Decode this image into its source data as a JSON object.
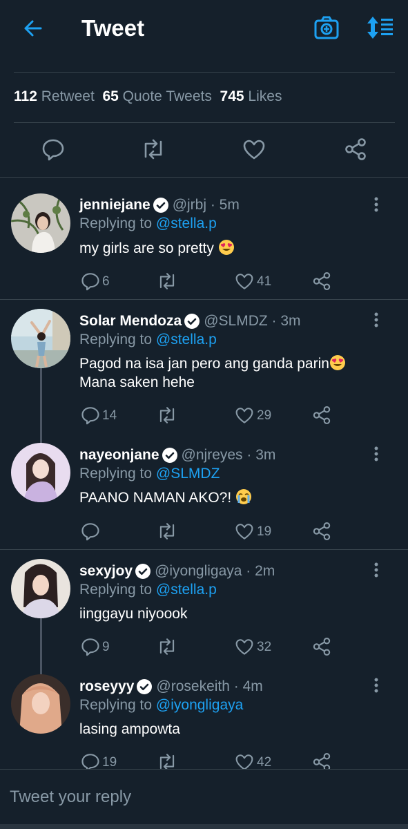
{
  "header": {
    "title": "Tweet"
  },
  "stats": {
    "retweets": "112",
    "retweets_label": "Retweet",
    "quotes": "65",
    "quotes_label": "Quote Tweets",
    "likes": "745",
    "likes_label": "Likes"
  },
  "replies": [
    {
      "name": "jenniejane",
      "handle": "@jrbj · 5m",
      "replying_prefix": "Replying to",
      "replying_to": "@stella.p",
      "text": "my girls are so pretty",
      "comments": "6",
      "likes": "41"
    },
    {
      "name": "Solar Mendoza",
      "handle": "@SLMDZ · 3m",
      "replying_prefix": "Replying to",
      "replying_to": "@stella.p",
      "text": "Pagod na isa jan pero ang ganda parin",
      "text2": "Mana saken hehe",
      "comments": "14",
      "likes": "29"
    },
    {
      "name": "nayeonjane",
      "handle": "@njreyes · 3m",
      "replying_prefix": "Replying to",
      "replying_to": "@SLMDZ",
      "text": "PAANO NAMAN AKO?!",
      "comments": "",
      "likes": "19"
    },
    {
      "name": "sexyjoy",
      "handle": "@iyongligaya · 2m",
      "replying_prefix": "Replying to",
      "replying_to": "@stella.p",
      "text": "iinggayu niyoook",
      "comments": "9",
      "likes": "32"
    },
    {
      "name": "roseyyy",
      "handle": "@rosekeith · 4m",
      "replying_prefix": "Replying to",
      "replying_to": "@iyongligaya",
      "text": "lasing ampowta",
      "comments": "19",
      "likes": "42"
    }
  ],
  "compose": {
    "placeholder": "Tweet your reply"
  },
  "colors": {
    "background": "#15202b",
    "accent": "#1da1f2",
    "muted": "#8899a6",
    "divider": "#38444d"
  }
}
